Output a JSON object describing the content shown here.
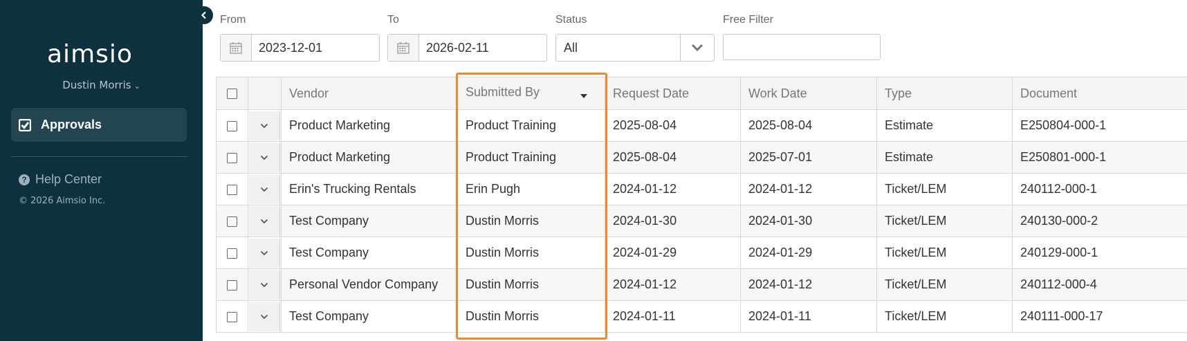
{
  "sidebar": {
    "logo_text": "aimsio",
    "user_name": "Dustin Morris",
    "nav_active_label": "Approvals",
    "help_label": "Help Center",
    "copyright": "© 2026 Aimsio Inc."
  },
  "filters": {
    "from_label": "From",
    "from_value": "2023-12-01",
    "to_label": "To",
    "to_value": "2026-02-11",
    "status_label": "Status",
    "status_value": "All",
    "free_label": "Free Filter",
    "free_value": ""
  },
  "table": {
    "headers": [
      "Vendor",
      "Submitted By",
      "Request Date",
      "Work Date",
      "Type",
      "Document"
    ],
    "rows": [
      [
        "Product Marketing",
        "Product Training",
        "2025-08-04",
        "2025-08-04",
        "Estimate",
        "E250804-000-1"
      ],
      [
        "Product Marketing",
        "Product Training",
        "2025-08-04",
        "2025-07-01",
        "Estimate",
        "E250801-000-1"
      ],
      [
        "Erin's Trucking Rentals",
        "Erin Pugh",
        "2024-01-12",
        "2024-01-12",
        "Ticket/LEM",
        "240112-000-1"
      ],
      [
        "Test Company",
        "Dustin Morris",
        "2024-01-30",
        "2024-01-30",
        "Ticket/LEM",
        "240130-000-2"
      ],
      [
        "Test Company",
        "Dustin Morris",
        "2024-01-29",
        "2024-01-29",
        "Ticket/LEM",
        "240129-000-1"
      ],
      [
        "Personal Vendor Company",
        "Dustin Morris",
        "2024-01-12",
        "2024-01-12",
        "Ticket/LEM",
        "240112-000-4"
      ],
      [
        "Test Company",
        "Dustin Morris",
        "2024-01-11",
        "2024-01-11",
        "Ticket/LEM",
        "240111-000-17"
      ]
    ]
  },
  "colors": {
    "sidebar_bg": "#0e3140",
    "highlight": "#f0892b"
  }
}
